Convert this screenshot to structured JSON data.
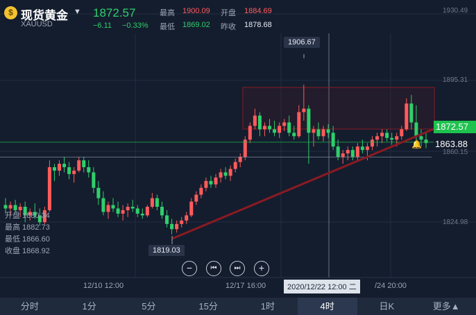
{
  "header": {
    "logo_glyph": "$",
    "title": "现货黄金",
    "symbol": "XAUUSD",
    "price": "1872.57",
    "change": "−6.11",
    "change_pct": "−0.33%",
    "high_label": "最高",
    "high_value": "1900.09",
    "open_label": "开盘",
    "open_value": "1884.69",
    "low_label": "最低",
    "low_value": "1869.02",
    "prev_close_label": "昨收",
    "prev_close_value": "1878.68"
  },
  "ohlc_panel": {
    "open": "开盘 1880.34",
    "high": "最高 1882.73",
    "low": "最低 1866.60",
    "close": "收盘 1868.92"
  },
  "annotations": {
    "high_marker": "1906.67",
    "low_marker": "1819.03",
    "current_price_tag": "1872.57",
    "alert_price_tag": "1863.88"
  },
  "y_axis_labels": [
    "1930.49",
    "1895.31",
    "1860.15",
    "1824.98"
  ],
  "x_axis_labels": [
    "12/10 12:00",
    "12/17 16:00",
    "/24 20:00"
  ],
  "crosshair_time": "2020/12/22 12:00 二",
  "controls": {
    "zoom_out": "−",
    "prev": "⏮",
    "next": "⏭",
    "zoom_in": "+"
  },
  "tabs": [
    "分时",
    "1分",
    "5分",
    "15分",
    "1时",
    "4时",
    "日K",
    "更多▲"
  ],
  "active_tab": "4时",
  "colors": {
    "background": "#141d2e",
    "up": "#ff5b5b",
    "down": "#2fcf6a",
    "current_price": "#1ec24e",
    "trend_line": "#8b1a22"
  },
  "chart_data": {
    "type": "candlestick",
    "ylim": [
      1810,
      1935
    ],
    "candles": [
      [
        1836,
        1840,
        1831,
        1834
      ],
      [
        1834,
        1838,
        1830,
        1836
      ],
      [
        1836,
        1839,
        1832,
        1833
      ],
      [
        1833,
        1837,
        1829,
        1835
      ],
      [
        1835,
        1838,
        1826,
        1830
      ],
      [
        1830,
        1834,
        1827,
        1832
      ],
      [
        1832,
        1837,
        1828,
        1830
      ],
      [
        1830,
        1834,
        1824,
        1826
      ],
      [
        1826,
        1835,
        1825,
        1833
      ],
      [
        1833,
        1862,
        1832,
        1858
      ],
      [
        1858,
        1860,
        1850,
        1856
      ],
      [
        1856,
        1862,
        1853,
        1860
      ],
      [
        1860,
        1864,
        1855,
        1858
      ],
      [
        1858,
        1861,
        1851,
        1854
      ],
      [
        1854,
        1858,
        1849,
        1856
      ],
      [
        1856,
        1864,
        1855,
        1862
      ],
      [
        1862,
        1864,
        1855,
        1858
      ],
      [
        1858,
        1862,
        1852,
        1855
      ],
      [
        1855,
        1858,
        1843,
        1846
      ],
      [
        1846,
        1850,
        1836,
        1840
      ],
      [
        1840,
        1844,
        1830,
        1832
      ],
      [
        1832,
        1838,
        1828,
        1836
      ],
      [
        1836,
        1840,
        1832,
        1834
      ],
      [
        1834,
        1838,
        1829,
        1831
      ],
      [
        1831,
        1836,
        1827,
        1833
      ],
      [
        1833,
        1837,
        1829,
        1835
      ],
      [
        1835,
        1839,
        1832,
        1834
      ],
      [
        1834,
        1836,
        1829,
        1831
      ],
      [
        1831,
        1834,
        1828,
        1830
      ],
      [
        1830,
        1836,
        1829,
        1835
      ],
      [
        1835,
        1843,
        1834,
        1840
      ],
      [
        1840,
        1842,
        1833,
        1835
      ],
      [
        1835,
        1838,
        1828,
        1830
      ],
      [
        1830,
        1833,
        1823,
        1825
      ],
      [
        1825,
        1828,
        1819,
        1822
      ],
      [
        1822,
        1827,
        1820,
        1825
      ],
      [
        1825,
        1829,
        1823,
        1827
      ],
      [
        1827,
        1832,
        1825,
        1830
      ],
      [
        1830,
        1840,
        1829,
        1838
      ],
      [
        1838,
        1844,
        1836,
        1842
      ],
      [
        1842,
        1848,
        1840,
        1846
      ],
      [
        1846,
        1852,
        1844,
        1850
      ],
      [
        1850,
        1853,
        1846,
        1848
      ],
      [
        1848,
        1854,
        1846,
        1852
      ],
      [
        1852,
        1857,
        1849,
        1855
      ],
      [
        1855,
        1858,
        1851,
        1853
      ],
      [
        1853,
        1859,
        1850,
        1857
      ],
      [
        1857,
        1863,
        1855,
        1861
      ],
      [
        1861,
        1866,
        1858,
        1864
      ],
      [
        1864,
        1876,
        1862,
        1874
      ],
      [
        1874,
        1884,
        1872,
        1882
      ],
      [
        1882,
        1892,
        1880,
        1888
      ],
      [
        1888,
        1890,
        1876,
        1880
      ],
      [
        1880,
        1884,
        1876,
        1882
      ],
      [
        1882,
        1886,
        1878,
        1880
      ],
      [
        1880,
        1885,
        1876,
        1878
      ],
      [
        1878,
        1884,
        1875,
        1882
      ],
      [
        1882,
        1886,
        1879,
        1884
      ],
      [
        1884,
        1888,
        1876,
        1878
      ],
      [
        1878,
        1882,
        1874,
        1876
      ],
      [
        1876,
        1894,
        1875,
        1890
      ],
      [
        1890,
        1906,
        1885,
        1892
      ],
      [
        1892,
        1894,
        1860,
        1878
      ],
      [
        1878,
        1882,
        1870,
        1880
      ],
      [
        1880,
        1884,
        1874,
        1876
      ],
      [
        1876,
        1882,
        1873,
        1880
      ],
      [
        1880,
        1883,
        1875,
        1878
      ],
      [
        1878,
        1882,
        1868,
        1870
      ],
      [
        1870,
        1874,
        1862,
        1864
      ],
      [
        1864,
        1868,
        1860,
        1866
      ],
      [
        1866,
        1870,
        1862,
        1868
      ],
      [
        1868,
        1870,
        1862,
        1864
      ],
      [
        1864,
        1872,
        1862,
        1870
      ],
      [
        1870,
        1874,
        1866,
        1868
      ],
      [
        1868,
        1872,
        1862,
        1870
      ],
      [
        1870,
        1876,
        1868,
        1874
      ],
      [
        1874,
        1878,
        1870,
        1876
      ],
      [
        1876,
        1880,
        1872,
        1878
      ],
      [
        1878,
        1880,
        1873,
        1875
      ],
      [
        1875,
        1878,
        1871,
        1874
      ],
      [
        1874,
        1878,
        1870,
        1876
      ],
      [
        1876,
        1882,
        1874,
        1880
      ],
      [
        1880,
        1898,
        1879,
        1895
      ],
      [
        1895,
        1900,
        1880,
        1884
      ],
      [
        1884,
        1894,
        1871,
        1876
      ],
      [
        1876,
        1880,
        1870,
        1874
      ],
      [
        1874,
        1878,
        1869,
        1872
      ]
    ]
  }
}
